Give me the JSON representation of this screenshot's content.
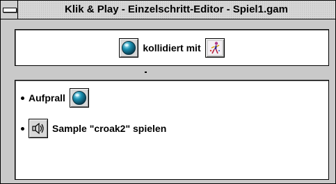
{
  "window": {
    "title": "Klik & Play - Einzelschritt-Editor - Spiel1.gam"
  },
  "condition": {
    "text": "kollidiert mit",
    "object_icon": "ball-object-icon",
    "target_icon": "character-object-icon"
  },
  "actions": [
    {
      "label": "Aufprall",
      "icon": "ball-object-icon"
    },
    {
      "label": "Sample \"croak2\" spielen",
      "icon": "speaker-sound-icon"
    }
  ],
  "colors": {
    "window_bg": "#c9c9c9",
    "titlebar_bg": "#d6d6d6",
    "panel_bg": "#ffffff",
    "ball_highlight": "#bff4ff",
    "ball_mid": "#1a8fb0",
    "ball_dark": "#0a3e52"
  }
}
